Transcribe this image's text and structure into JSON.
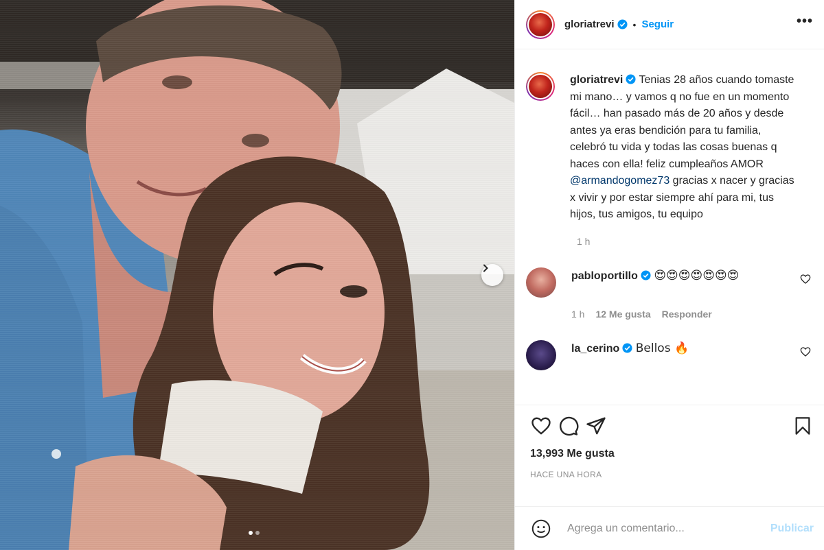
{
  "post": {
    "username": "gloriatrevi",
    "follow_label": "Seguir",
    "separator": "•",
    "more_label": "•••",
    "caption_user": "gloriatrevi",
    "caption_before": " Tenias 28 años cuando tomaste mi mano… y vamos q no fue en un momento fácil… han pasado más de 20 años y desde antes ya eras bendición para tu familia, celebró tu vida y todas las cosas buenas q haces con ella! feliz cumpleaños AMOR ",
    "caption_mention": "@armandogomez73",
    "caption_after": " gracias x nacer y gracias x vivir y por estar siempre ahí para mi, tus hijos, tus amigos, tu equipo",
    "caption_time": "1 h"
  },
  "comments": [
    {
      "username": "pabloportillo",
      "text": "😍😍😍😍😍😍😍",
      "time": "1 h",
      "likes": "12 Me gusta",
      "reply": "Responder"
    },
    {
      "username": "la_cerino",
      "text": "Bellos 🔥"
    }
  ],
  "footer": {
    "likes": "13,993 Me gusta",
    "posted": "HACE UNA HORA",
    "comment_placeholder": "Agrega un comentario...",
    "publish_label": "Publicar"
  },
  "icons": {
    "verified": "verified-badge-icon",
    "like": "heart-icon",
    "comment": "comment-icon",
    "share": "share-icon",
    "save": "bookmark-icon",
    "next": "chevron-right-icon",
    "emoji": "smiley-icon"
  },
  "colors": {
    "accent": "#0095f6",
    "mention": "#00376b",
    "muted": "#8e8e8e",
    "publish_disabled": "#b2dffc"
  },
  "carousel": {
    "count": 2,
    "active": 0
  }
}
